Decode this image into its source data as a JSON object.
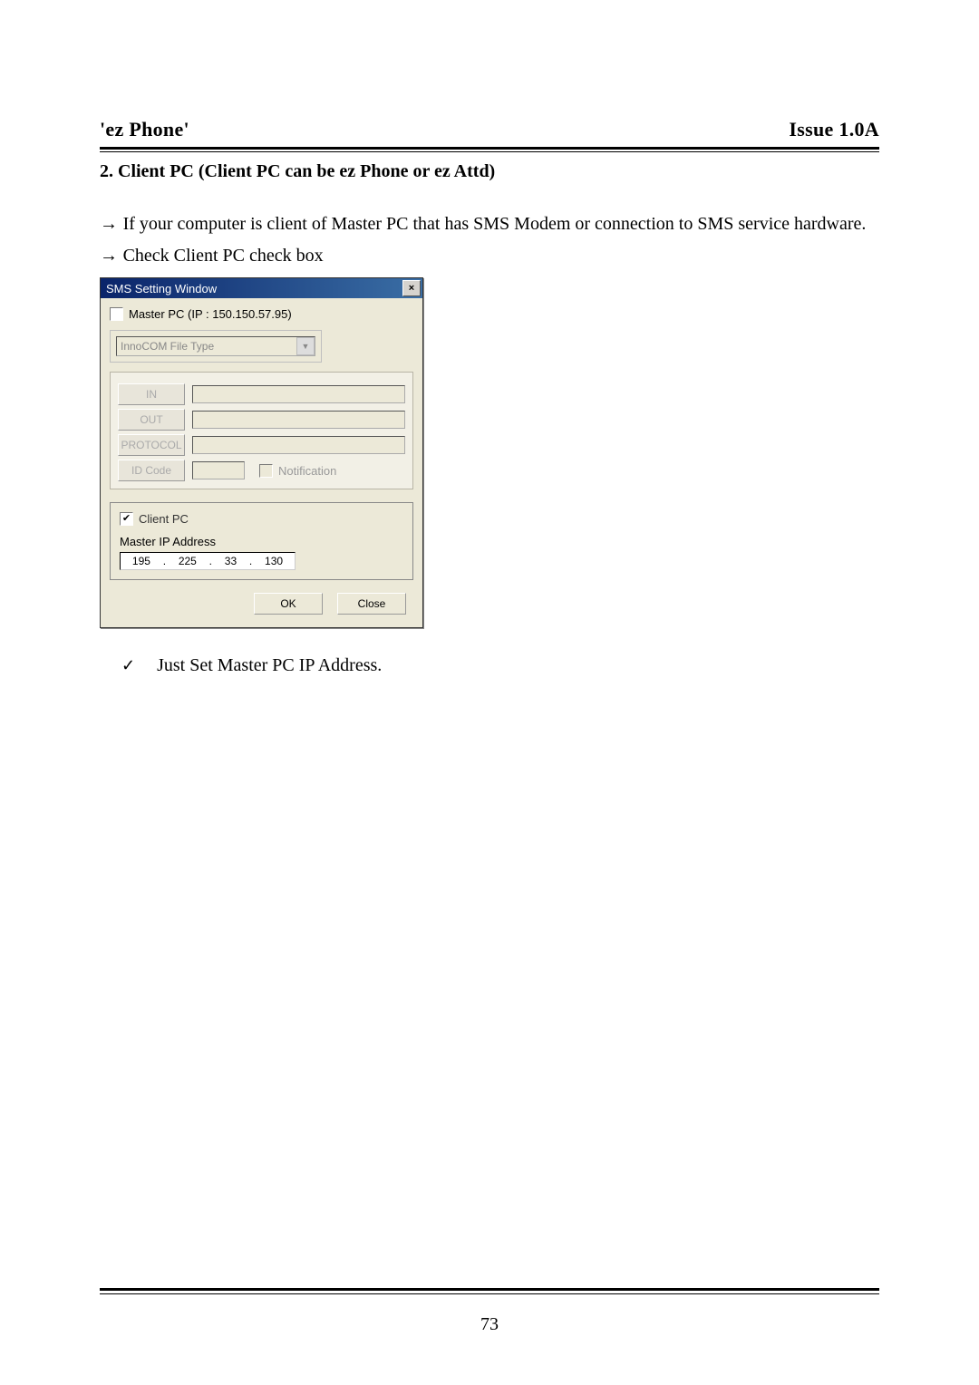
{
  "header": {
    "left": "'ez Phone'",
    "right": "Issue 1.0A"
  },
  "section_title": "2. Client PC (Client PC can be ez Phone or ez Attd)",
  "body": {
    "line1_a": "→ ",
    "line1_b": "If your computer is client of Master PC that has SMS Modem or connection to SMS service hardware.",
    "line2_a": "→ ",
    "line2_b": "Check Client PC check box"
  },
  "dialog": {
    "title": "SMS Setting Window",
    "close": "×",
    "master_label": "Master PC (IP : 150.150.57.95)",
    "combo_text": "InnoCOM File Type",
    "btn_in": "IN",
    "btn_out": "OUT",
    "btn_protocol": "PROTOCOL",
    "btn_idcode": "ID Code",
    "notif_label": "Notification",
    "client_label": "Client PC",
    "ip_label": "Master IP Address",
    "ip": {
      "a": "195",
      "b": "225",
      "c": "33",
      "d": "130"
    },
    "ok": "OK",
    "close_btn": "Close"
  },
  "note": {
    "tick": "✓",
    "text": "Just Set Master PC IP Address."
  },
  "page_number": "73"
}
